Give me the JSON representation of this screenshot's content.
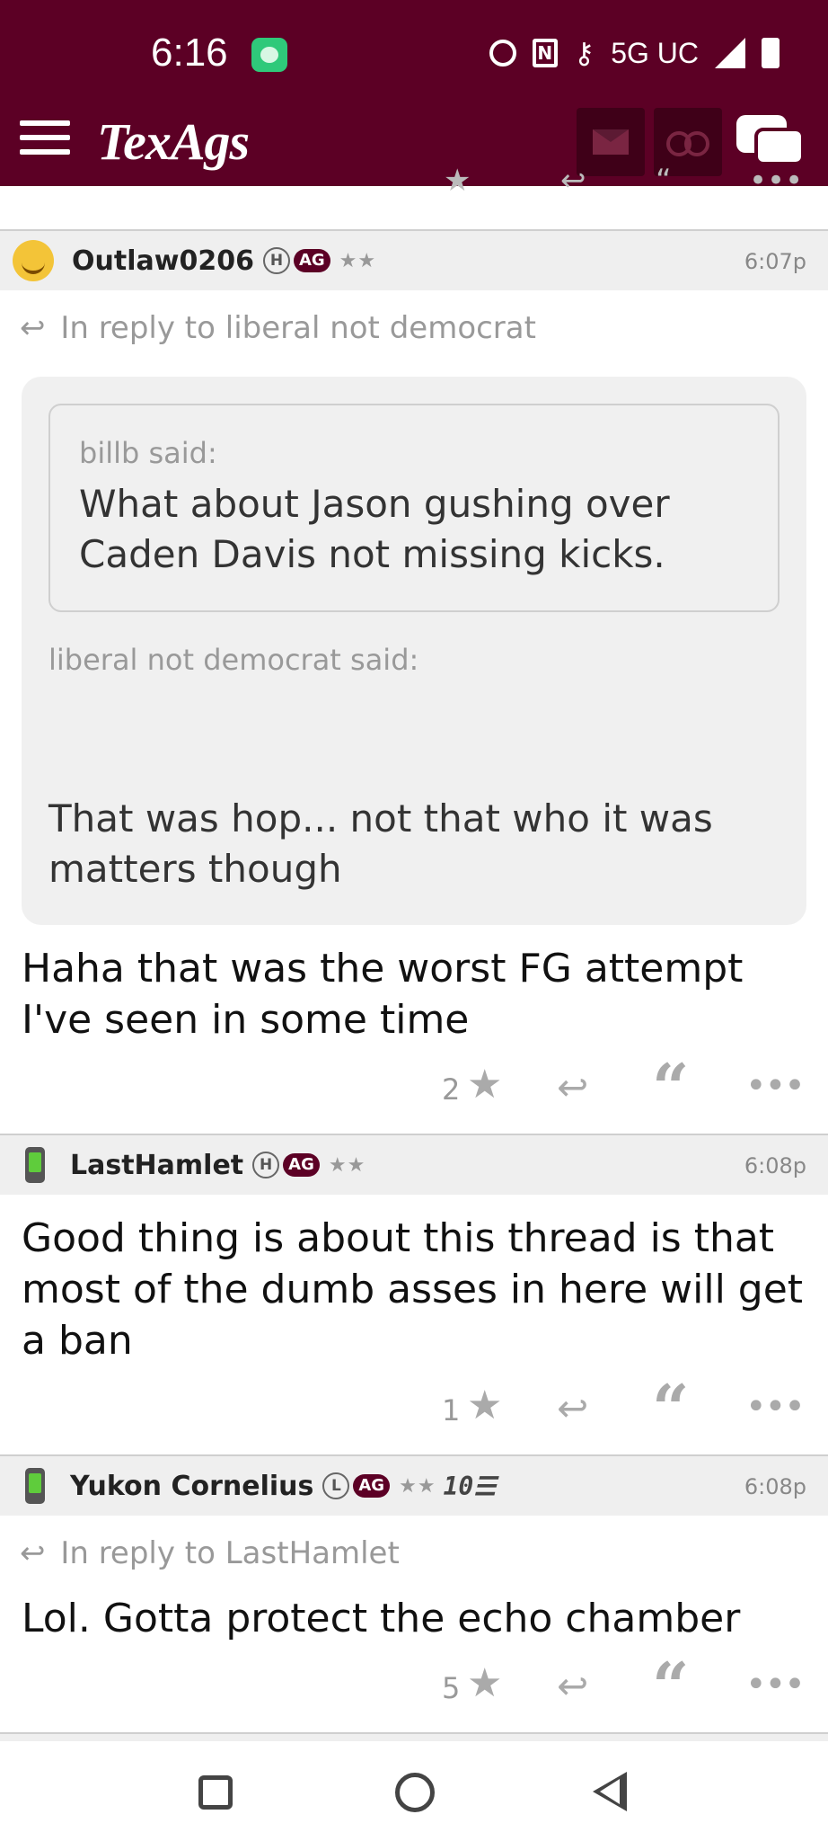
{
  "status_bar": {
    "time": "6:16",
    "network": "5G UC"
  },
  "header": {
    "logo": "TexAgs"
  },
  "posts": [
    {
      "username": "Outlaw0206",
      "badge_letter": "H",
      "badge_ag": "AG",
      "stars": "★★",
      "time": "6:07p",
      "reply_to": "In reply to liberal not democrat",
      "quote": {
        "inner_author": "billb said:",
        "inner_text": "What about Jason gushing over Caden Davis not missing kicks.",
        "outer_author": "liberal not democrat said:",
        "outer_text": "That was hop... not that who it was matters though"
      },
      "body": "Haha that was the worst FG attempt I've seen in some time",
      "star_count": "2"
    },
    {
      "username": "LastHamlet",
      "badge_letter": "H",
      "badge_ag": "AG",
      "stars": "★★",
      "time": "6:08p",
      "body": "Good thing is about this thread is that most of the dumb asses in here will get a ban",
      "star_count": "1"
    },
    {
      "username": "Yukon Cornelius",
      "badge_letter": "L",
      "badge_ag": "AG",
      "stars": "★★",
      "rank": "10☰",
      "time": "6:08p",
      "reply_to": "In reply to LastHamlet",
      "body": "Lol. Gotta protect the echo chamber",
      "star_count": "5"
    }
  ],
  "icons": {
    "star": "★",
    "reply": "↩",
    "quote": "“",
    "more": "•••"
  }
}
